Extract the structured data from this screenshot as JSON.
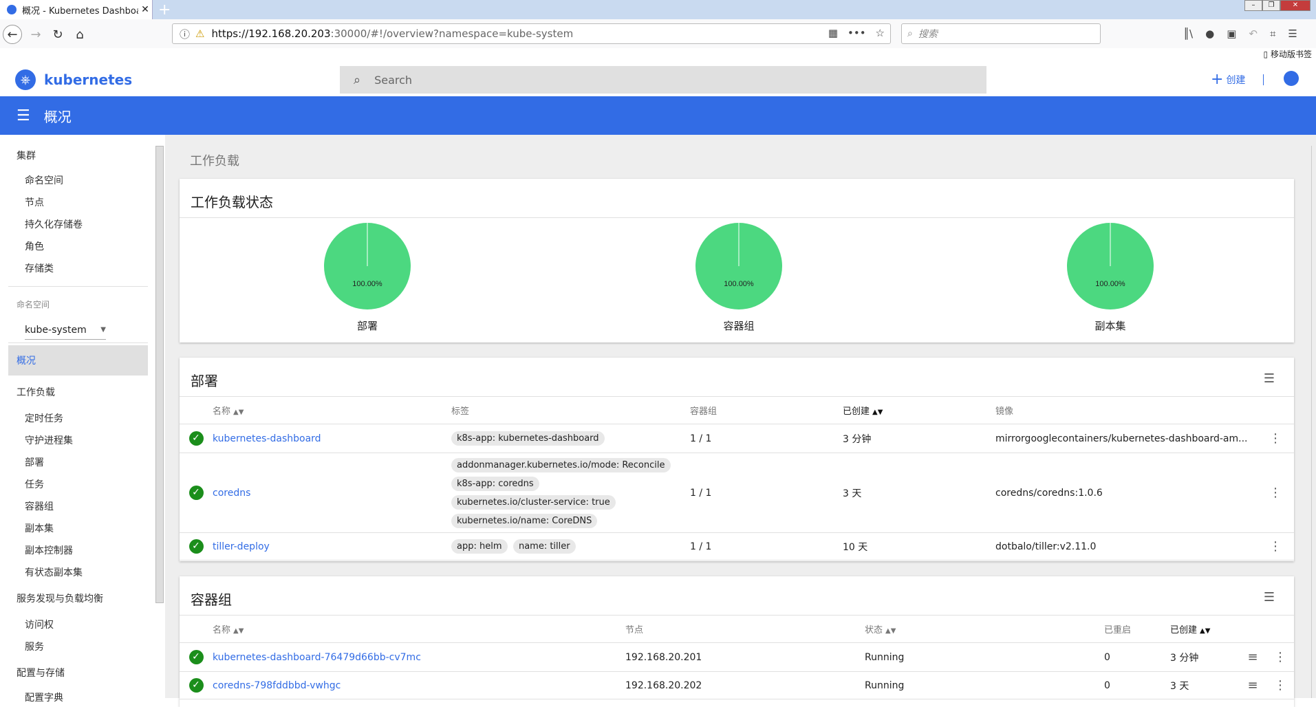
{
  "browser": {
    "tab_title": "概况 - Kubernetes Dashboard",
    "url_host": "https://192.168.20.203",
    "url_rest": ":30000/#!/overview?namespace=kube-system",
    "search_placeholder": "搜索",
    "mobile_bookmarks": "移动版书签"
  },
  "header": {
    "brand": "kubernetes",
    "search_placeholder": "Search",
    "create_label": "创建"
  },
  "toolbar": {
    "title": "概况"
  },
  "sidebar": {
    "cluster": "集群",
    "cluster_items": [
      "命名空间",
      "节点",
      "持久化存储卷",
      "角色",
      "存储类"
    ],
    "namespace_label": "命名空间",
    "namespace_value": "kube-system",
    "overview": "概况",
    "workloads": "工作负载",
    "workload_items": [
      "定时任务",
      "守护进程集",
      "部署",
      "任务",
      "容器组",
      "副本集",
      "副本控制器",
      "有状态副本集"
    ],
    "discovery": "服务发现与负载均衡",
    "discovery_items": [
      "访问权",
      "服务"
    ],
    "config": "配置与存储",
    "config_items": [
      "配置字典"
    ]
  },
  "main": {
    "breadcrumb": "工作负载",
    "status_card": {
      "title": "工作负载状态",
      "charts": [
        {
          "label": "部署",
          "percent": "100.00%",
          "value": 100
        },
        {
          "label": "容器组",
          "percent": "100.00%",
          "value": 100
        },
        {
          "label": "副本集",
          "percent": "100.00%",
          "value": 100
        }
      ]
    },
    "deployments": {
      "title": "部署",
      "headers": [
        "名称",
        "标签",
        "容器组",
        "已创建",
        "镜像"
      ],
      "rows": [
        {
          "name": "kubernetes-dashboard",
          "labels": [
            "k8s-app: kubernetes-dashboard"
          ],
          "pods": "1 / 1",
          "created": "3 分钟",
          "image": "mirrorgooglecontainers/kubernetes-dashboard-am..."
        },
        {
          "name": "coredns",
          "labels": [
            "addonmanager.kubernetes.io/mode: Reconcile",
            "k8s-app: coredns",
            "kubernetes.io/cluster-service: true",
            "kubernetes.io/name: CoreDNS"
          ],
          "pods": "1 / 1",
          "created": "3 天",
          "image": "coredns/coredns:1.0.6"
        },
        {
          "name": "tiller-deploy",
          "labels": [
            "app: helm",
            "name: tiller"
          ],
          "pods": "1 / 1",
          "created": "10 天",
          "image": "dotbalo/tiller:v2.11.0"
        }
      ]
    },
    "pods": {
      "title": "容器组",
      "headers": [
        "名称",
        "节点",
        "状态",
        "已重启",
        "已创建"
      ],
      "rows": [
        {
          "name": "kubernetes-dashboard-76479d66bb-cv7mc",
          "node": "192.168.20.201",
          "status": "Running",
          "restarts": "0",
          "created": "3 分钟"
        },
        {
          "name": "coredns-798fddbbd-vwhgc",
          "node": "192.168.20.202",
          "status": "Running",
          "restarts": "0",
          "created": "3 天"
        }
      ]
    }
  },
  "colors": {
    "brand": "#326ce5",
    "pie": "#4cd880",
    "ok": "#1b8e1b"
  }
}
